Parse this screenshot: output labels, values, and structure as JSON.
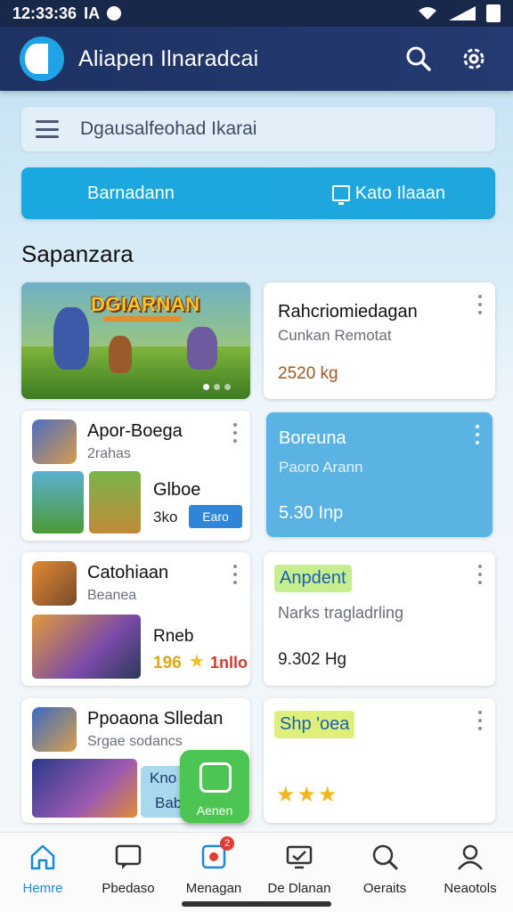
{
  "status_bar": {
    "time": "12:33:36",
    "label": "IA"
  },
  "app_bar": {
    "title": "Aliapen Ilnaradcai",
    "search_icon": "search-icon",
    "settings_icon": "gear-icon"
  },
  "search": {
    "text": "Dgausalfeohad Ikarai"
  },
  "banner": {
    "left_label": "Barnadann",
    "right_label": "Kato Ilaaan"
  },
  "section": {
    "title": "Sapanzara"
  },
  "cards": {
    "featured": {
      "game_title": "DGIARNAN"
    },
    "info1": {
      "title": "Rahcriomiedagan",
      "subtitle": "Cunkan Remotat",
      "value": "2520 kg"
    },
    "app1": {
      "name": "Apor-Boega",
      "subtitle": "2rahas",
      "thumb_title": "Glboe",
      "thumb_value": "3ko",
      "button": "Earo"
    },
    "blue": {
      "title": "Boreuna",
      "subtitle": "Paoro Arann",
      "value": "5.30 Inp"
    },
    "app2": {
      "name": "Catohiaan",
      "subtitle": "Beanea",
      "thumb_title": "Rneb",
      "rating_value": "196",
      "rating_suffix": "1nllo"
    },
    "info2": {
      "pill": "Anpdent",
      "subtitle": "Narks tragladrling",
      "value": "9.302 Hg"
    },
    "app3": {
      "name": "Ppoaona Slledan",
      "subtitle": "Srgae sodancs",
      "thumb_title": "Kno",
      "thumb_sub": "Bab"
    },
    "info3": {
      "pill": "Shp 'oea",
      "stars": "★★★"
    }
  },
  "fab": {
    "label": "Aenen"
  },
  "bottom_nav": [
    {
      "label": "Hemre",
      "icon": "home-icon",
      "active": true
    },
    {
      "label": "Pbedaso",
      "icon": "chat-icon",
      "active": false
    },
    {
      "label": "Menagan",
      "icon": "manage-icon",
      "active": false,
      "badge": "2"
    },
    {
      "label": "De Dlanan",
      "icon": "monitor-icon",
      "active": false
    },
    {
      "label": "Oeraits",
      "icon": "search-icon",
      "active": false
    },
    {
      "label": "Neaotols",
      "icon": "profile-icon",
      "active": false
    }
  ],
  "colors": {
    "app_bar": "#1e3263",
    "accent": "#1aa8e0",
    "active_nav": "#1a8ad6",
    "fab": "#4cc552",
    "blue_card": "#5ab3e3"
  }
}
